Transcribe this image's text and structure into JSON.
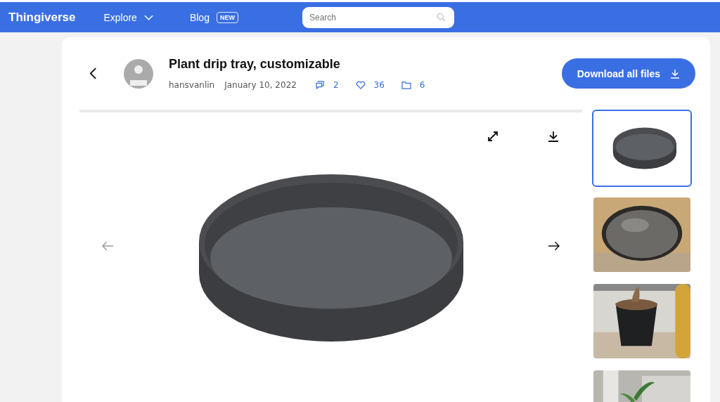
{
  "nav": {
    "logo": "Thingiverse",
    "items": [
      {
        "label": "Explore",
        "kind": "dropdown"
      },
      {
        "label": "Blog",
        "kind": "badge",
        "badge": "NEW"
      }
    ],
    "search": {
      "placeholder": "Search"
    }
  },
  "thing": {
    "title": "Plant drip tray, customizable",
    "author": "hansvanlin",
    "date": "January 10, 2022",
    "comments": "2",
    "likes": "36",
    "files": "6"
  },
  "download_button": "Download all files",
  "thumbnails": [
    {
      "kind": "render",
      "selected": true
    },
    {
      "kind": "photo-tray",
      "selected": false
    },
    {
      "kind": "photo-pot",
      "selected": false
    },
    {
      "kind": "photo-plant",
      "selected": false
    }
  ]
}
